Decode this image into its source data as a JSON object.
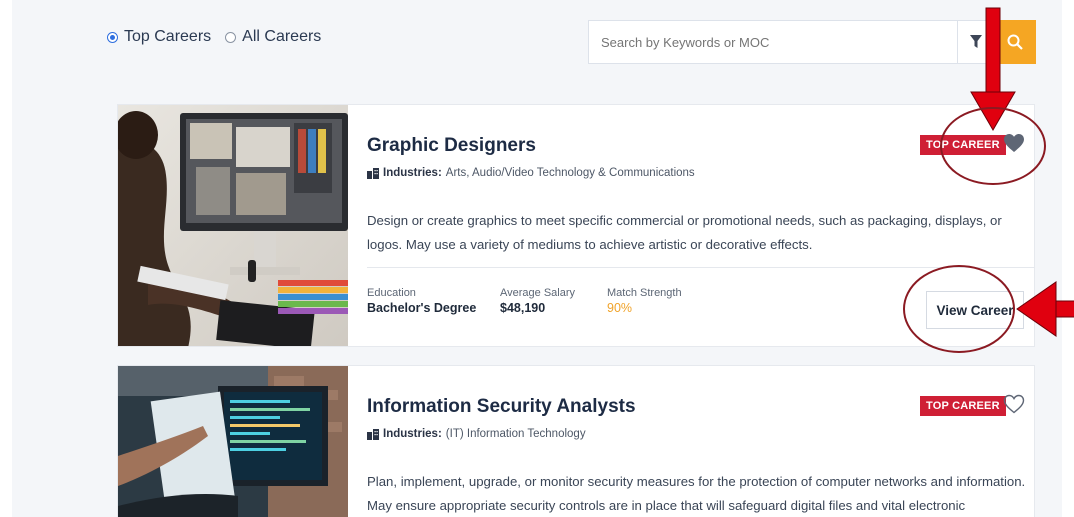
{
  "filters": {
    "options": [
      {
        "label": "Top Careers",
        "selected": true
      },
      {
        "label": "All Careers",
        "selected": false
      }
    ]
  },
  "search": {
    "placeholder": "Search by Keywords or MOC",
    "filter_icon": "funnel-icon",
    "search_icon": "magnifier-icon"
  },
  "careers": [
    {
      "title": "Graphic Designers",
      "industries_label": "Industries:",
      "industries": "Arts, Audio/Video Technology & Communications",
      "badge": "TOP CAREER",
      "favorited": true,
      "description": "Design or create graphics to meet specific commercial or promotional needs, such as packaging, displays, or logos. May use a variety of mediums to achieve artistic or decorative effects.",
      "stats": [
        {
          "label": "Education",
          "value": "Bachelor's Degree"
        },
        {
          "label": "Average Salary",
          "value": "$48,190"
        },
        {
          "label": "Match Strength",
          "value": "90%"
        }
      ],
      "button": "View Career"
    },
    {
      "title": "Information Security Analysts",
      "industries_label": "Industries:",
      "industries": "(IT) Information Technology",
      "badge": "TOP CAREER",
      "favorited": false,
      "description": "Plan, implement, upgrade, or monitor security measures for the protection of computer networks and information. May ensure appropriate security controls are in place that will safeguard digital files and vital electronic infrastructure. May"
    }
  ],
  "colors": {
    "badge": "#cf1f35",
    "search_button": "#f5a623",
    "match": "#f0a32a",
    "annotation": "#8b1a22",
    "arrow": "#e0000f"
  }
}
